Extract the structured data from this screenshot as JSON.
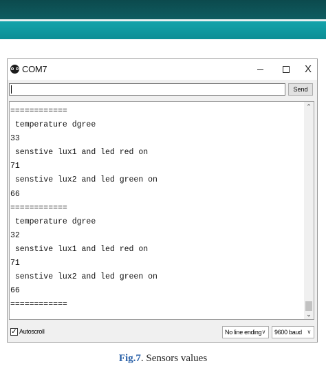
{
  "window": {
    "title": "COM7",
    "controls": {
      "minimize": "—",
      "maximize": "☐",
      "close": "X"
    }
  },
  "send": {
    "input_value": "",
    "button_label": "Send"
  },
  "serial_output": {
    "lines": [
      "============",
      " temperature dgree",
      "33",
      " senstive lux1 and led red on",
      "71",
      " senstive lux2 and led green on",
      "66",
      "============",
      " temperature dgree",
      "32",
      " senstive lux1 and led red on",
      "71",
      " senstive lux2 and led green on",
      "66",
      "============"
    ]
  },
  "statusbar": {
    "autoscroll_label": "Autoscroll",
    "autoscroll_checked": true,
    "line_ending_selected": "No line ending",
    "baud_selected": "9600 baud"
  },
  "caption": {
    "fig_label": "Fig.7",
    "text": ". Sensors values"
  },
  "colors": {
    "banner_dark": "#0f5d61",
    "banner_light": "#13a3aa",
    "caption_fig": "#2a61a8"
  }
}
